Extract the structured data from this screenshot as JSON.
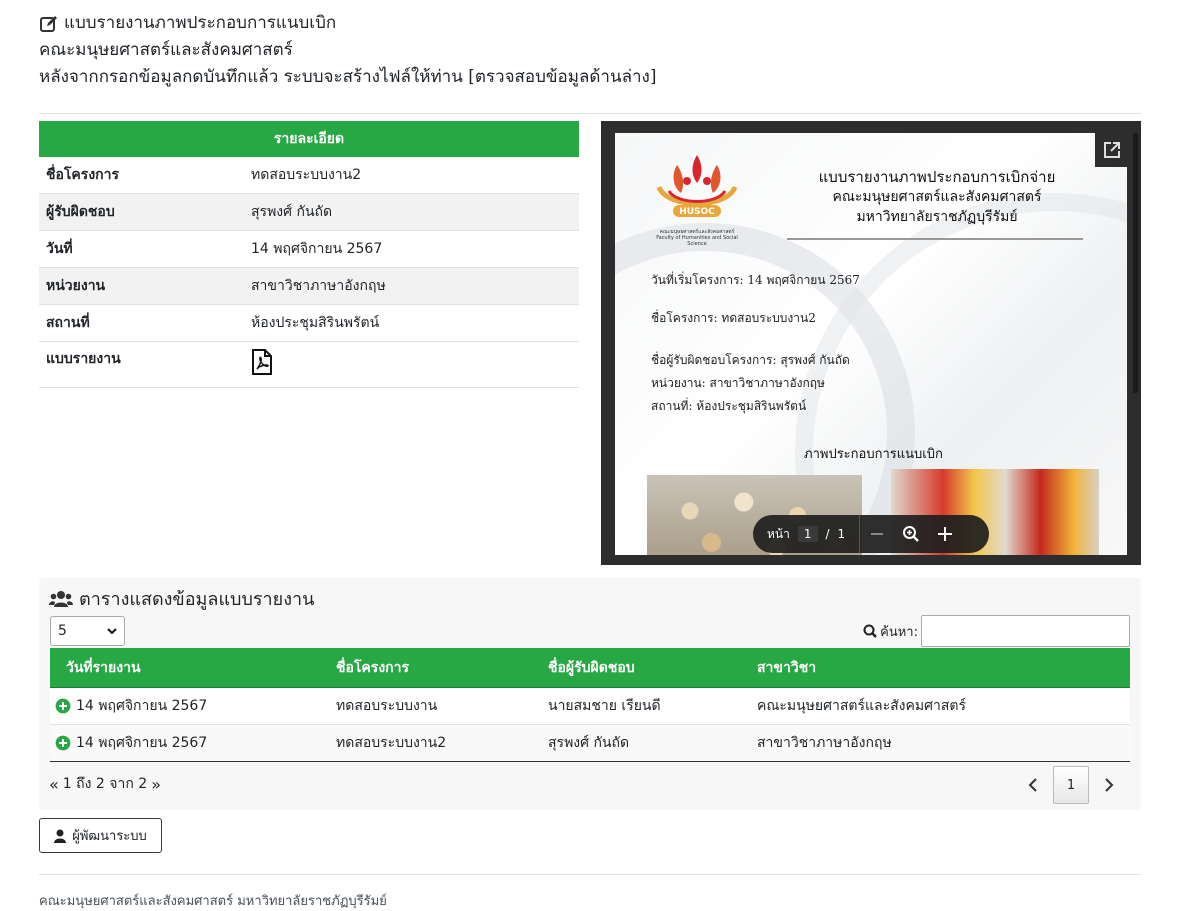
{
  "header": {
    "title": "แบบรายงานภาพประกอบการแนบเบิก",
    "faculty": "คณะมนุษยศาสตร์และสังคมศาสตร์",
    "instruction": "หลังจากกรอกข้อมูลกดบันทึกแล้ว ระบบจะสร้างไฟล์ให้ท่าน [ตรวจสอบข้อมูลด้านล่าง]"
  },
  "details": {
    "heading": "รายละเอียด",
    "rows": [
      {
        "label": "ชื่อโครงการ",
        "value": "ทดสอบระบบงาน2"
      },
      {
        "label": "ผู้รับผิดชอบ",
        "value": "สุรพงศ์ กันถัด"
      },
      {
        "label": "วันที่",
        "value": "14 พฤศจิกายน 2567"
      },
      {
        "label": "หน่วยงาน",
        "value": "สาขาวิชาภาษาอังกฤษ"
      },
      {
        "label": "สถานที่",
        "value": "ห้องประชุมสิรินพรัตน์"
      },
      {
        "label": "แบบรายงาน",
        "icon": "pdf-file-icon"
      }
    ]
  },
  "viewer": {
    "logo_brand": "HUSOC",
    "logo_caption_th": "คณะมนุษยศาสตร์และสังคมศาสตร์",
    "logo_caption_en": "Faculty of Humanities and Social Science",
    "doc_title_1": "แบบรายงานภาพประกอบการเบิกจ่าย",
    "doc_title_2": "คณะมนุษยศาสตร์และสังคมศาสตร์",
    "doc_title_3": "มหาวิทยาลัยราชภัฏบุรีรัมย์",
    "start_date": "วันที่เริ่มโครงการ: 14 พฤศจิกายน 2567",
    "project": "ชื่อโครงการ: ทดสอบระบบงาน2",
    "owner": "ชื่อผู้รับผิดชอบโครงการ: สุรพงศ์ กันถัด",
    "unit": "หน่วยงาน: สาขาวิชาภาษาอังกฤษ",
    "place": "สถานที่: ห้องประชุมสิรินพรัตน์",
    "photos_heading": "ภาพประกอบการแนบเบิก",
    "toolbar": {
      "page_label": "หน้า",
      "current_page": "1",
      "separator": "/",
      "total_pages": "1"
    }
  },
  "report_table": {
    "title": "ตารางแสดงข้อมูลแบบรายงาน",
    "page_size": "5",
    "search_label": "ค้นหา:",
    "search_value": "",
    "columns": [
      "วันที่รายงาน",
      "ชื่อโครงการ",
      "ชื่อผู้รับผิดชอบ",
      "สาขาวิชา"
    ],
    "rows": [
      [
        "14 พฤศจิกายน 2567",
        "ทดสอบระบบงาน",
        "นายสมชาย เรียนดี",
        "คณะมนุษยศาสตร์และสังคมศาสตร์"
      ],
      [
        "14 พฤศจิกายน 2567",
        "ทดสอบระบบงาน2",
        "สุรพงศ์ กันถัด",
        "สาขาวิชาภาษาอังกฤษ"
      ]
    ],
    "info": "1 ถึง 2 จาก 2",
    "current_page": "1"
  },
  "developer_button": "ผู้พัฒนาระบบ",
  "footer": "คณะมนุษยศาสตร์และสังคมศาสตร์ มหาวิทยาลัยราชภัฏบุรีรัมย์",
  "colors": {
    "accent": "#28a745",
    "viewer_bg": "#2d2d2d"
  }
}
